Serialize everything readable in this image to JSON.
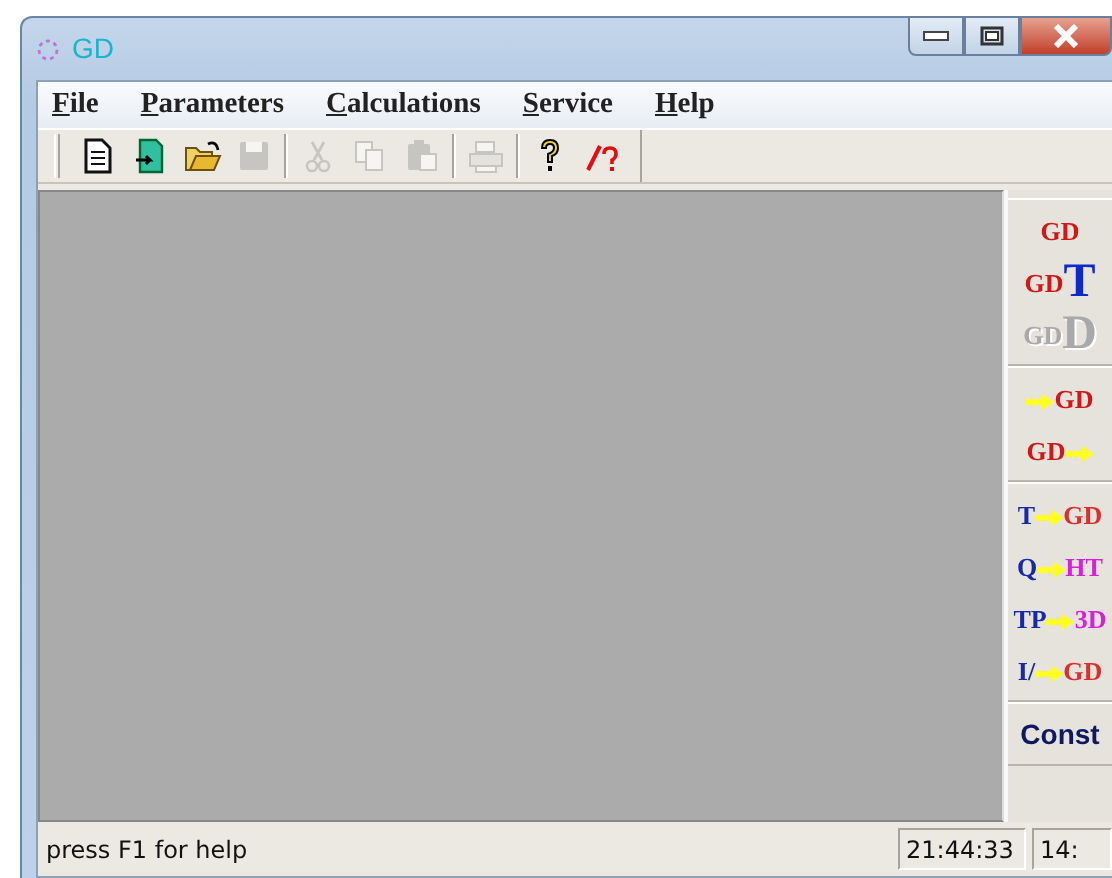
{
  "window": {
    "title": "GD"
  },
  "menu": [
    {
      "label": "File"
    },
    {
      "label": "Parameters"
    },
    {
      "label": "Calculations"
    },
    {
      "label": "Service"
    },
    {
      "label": "Help"
    }
  ],
  "toolbar": [
    {
      "kind": "new",
      "disabled": false
    },
    {
      "kind": "import",
      "disabled": false
    },
    {
      "kind": "open",
      "disabled": false
    },
    {
      "kind": "save",
      "disabled": true
    },
    {
      "kind": "separator"
    },
    {
      "kind": "cut",
      "disabled": true
    },
    {
      "kind": "copy",
      "disabled": true
    },
    {
      "kind": "paste",
      "disabled": true
    },
    {
      "kind": "separator"
    },
    {
      "kind": "print",
      "disabled": true
    },
    {
      "kind": "separator"
    },
    {
      "kind": "help",
      "disabled": false
    },
    {
      "kind": "context_help",
      "disabled": false
    }
  ],
  "side_panel": [
    [
      {
        "disabled": false,
        "parts": [
          {
            "kind": "text",
            "text": "GD",
            "color": "#d01818"
          }
        ]
      },
      {
        "disabled": false,
        "parts": [
          {
            "kind": "text",
            "text": "GD",
            "color": "#d01818"
          },
          {
            "kind": "big",
            "text": "T",
            "color": "#1028c8"
          }
        ]
      },
      {
        "disabled": true,
        "parts": [
          {
            "kind": "text",
            "text": "GD"
          },
          {
            "kind": "big",
            "text": "D"
          }
        ]
      }
    ],
    [
      {
        "disabled": false,
        "parts": [
          {
            "kind": "arrow"
          },
          {
            "kind": "text",
            "text": "GD",
            "color": "#d01818"
          }
        ]
      },
      {
        "disabled": false,
        "parts": [
          {
            "kind": "text",
            "text": "GD",
            "color": "#d01818"
          },
          {
            "kind": "arrow"
          }
        ]
      }
    ],
    [
      {
        "disabled": false,
        "parts": [
          {
            "kind": "text",
            "text": "T",
            "color": "#1828a8"
          },
          {
            "kind": "arrow"
          },
          {
            "kind": "text",
            "text": "GD",
            "color": "#d83030"
          }
        ]
      },
      {
        "disabled": false,
        "parts": [
          {
            "kind": "text",
            "text": "Q",
            "color": "#1828a8"
          },
          {
            "kind": "arrow"
          },
          {
            "kind": "text",
            "text": "HT",
            "color": "#d820d8"
          }
        ]
      },
      {
        "disabled": false,
        "parts": [
          {
            "kind": "text",
            "text": "TP",
            "color": "#1828a8"
          },
          {
            "kind": "arrow"
          },
          {
            "kind": "text",
            "text": "3D",
            "color": "#d820d8"
          }
        ]
      },
      {
        "disabled": false,
        "parts": [
          {
            "kind": "text",
            "text": "I/",
            "color": "#1828a8"
          },
          {
            "kind": "arrow"
          },
          {
            "kind": "text",
            "text": "GD",
            "color": "#d83030"
          }
        ]
      }
    ],
    [
      {
        "disabled": false,
        "parts": [
          {
            "kind": "sans",
            "text": "Const",
            "color": "#101860"
          }
        ]
      }
    ]
  ],
  "status_bar": {
    "message": "press F1 for help",
    "time": "21:44:33",
    "pane_3": "14:"
  }
}
